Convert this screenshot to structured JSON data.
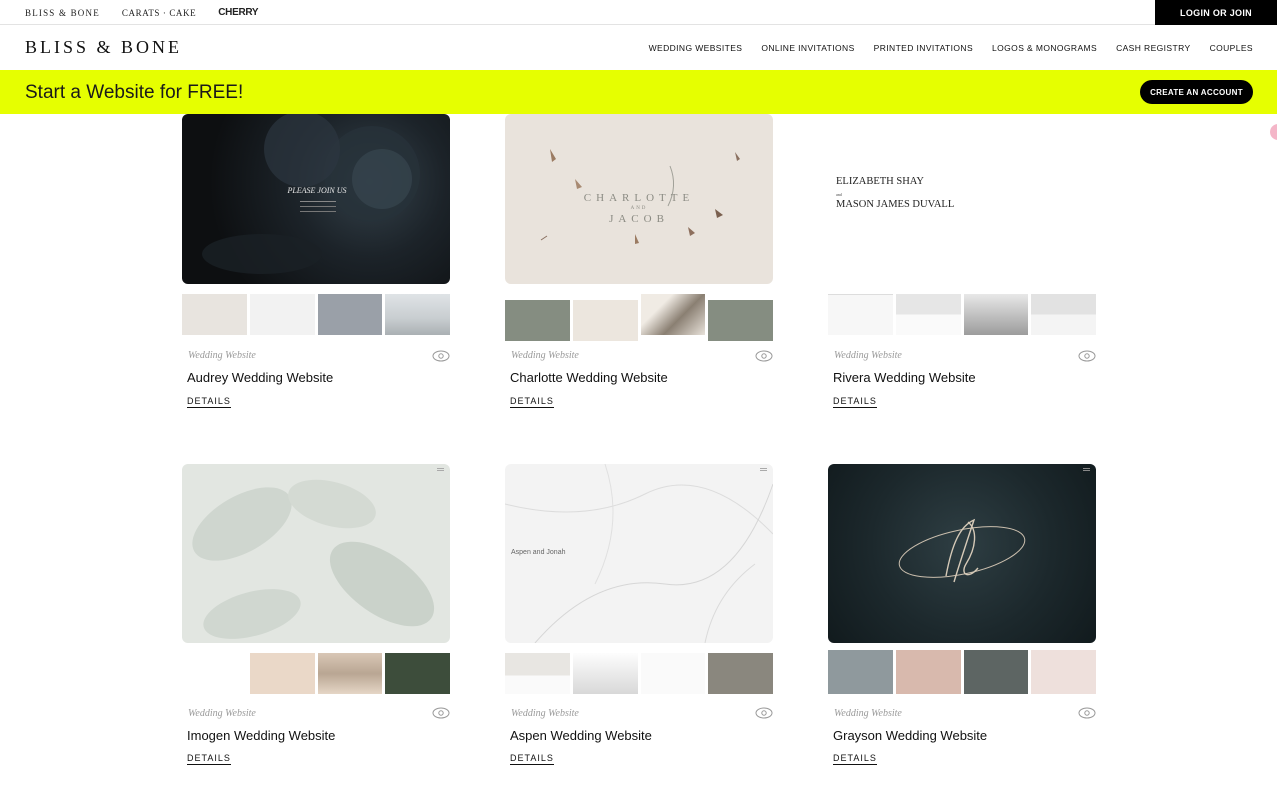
{
  "topbar": {
    "brands": [
      "BLISS & BONE",
      "CARATS · CAKE",
      "CHERRY"
    ],
    "login_label": "LOGIN OR JOIN"
  },
  "header": {
    "logo": "BLISS & BONE",
    "nav": [
      "WEDDING WEBSITES",
      "ONLINE INVITATIONS",
      "PRINTED INVITATIONS",
      "LOGOS & MONOGRAMS",
      "CASH REGISTRY",
      "COUPLES"
    ]
  },
  "promo": {
    "text": "Start a Website for FREE!",
    "button": "CREATE AN ACCOUNT",
    "background": "#e6ff00"
  },
  "cards": [
    {
      "type": "Wedding Website",
      "title": "Audrey Wedding Website",
      "details": "DETAILS",
      "preview_text": "PLEASE JOIN US"
    },
    {
      "type": "Wedding Website",
      "title": "Charlotte Wedding Website",
      "details": "DETAILS",
      "preview_text": "CHARLOTTE",
      "preview_and": "AND",
      "preview_text2": "JACOB"
    },
    {
      "type": "Wedding Website",
      "title": "Rivera Wedding Website",
      "details": "DETAILS",
      "preview_text": "ELIZABETH SHAY",
      "preview_text2": "MASON JAMES DUVALL"
    },
    {
      "type": "Wedding Website",
      "title": "Imogen Wedding Website",
      "details": "DETAILS"
    },
    {
      "type": "Wedding Website",
      "title": "Aspen Wedding Website",
      "details": "DETAILS",
      "preview_text": "Aspen and Jonah"
    },
    {
      "type": "Wedding Website",
      "title": "Grayson Wedding Website",
      "details": "DETAILS"
    }
  ]
}
